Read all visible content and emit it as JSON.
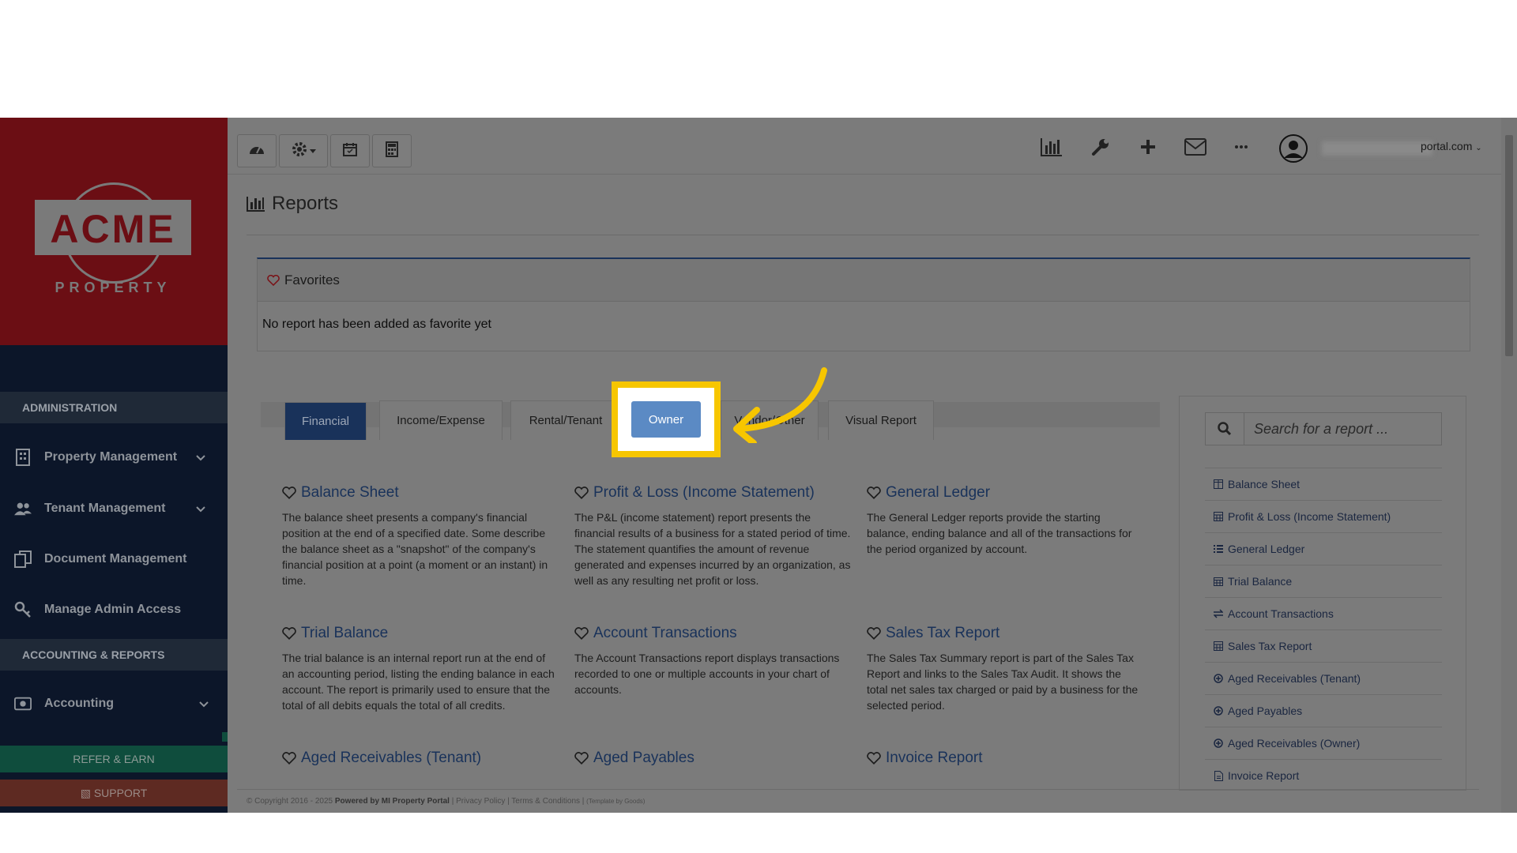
{
  "brand": {
    "logo_text": "ACME",
    "logo_sub": "PROPERTY"
  },
  "sidebar": {
    "section_admin": "ADMINISTRATION",
    "items": [
      {
        "label": "Property Management"
      },
      {
        "label": "Tenant Management"
      },
      {
        "label": "Document Management"
      },
      {
        "label": "Manage Admin Access"
      }
    ],
    "section_accounting": "ACCOUNTING & REPORTS",
    "accounting": "Accounting",
    "refer": "REFER & EARN",
    "support": "SUPPORT"
  },
  "topbar": {
    "user_email": "portal.com"
  },
  "page": {
    "title": "Reports"
  },
  "favorites": {
    "title": "Favorites",
    "empty": "No report has been added as favorite yet"
  },
  "tabs": [
    {
      "label": "Financial"
    },
    {
      "label": "Income/Expense"
    },
    {
      "label": "Rental/Tenant"
    },
    {
      "label": "Owner"
    },
    {
      "label": "Vendor/Other"
    },
    {
      "label": "Visual Report"
    }
  ],
  "reports": [
    {
      "title": "Balance Sheet",
      "desc": "The balance sheet presents a company's financial position at the end of a specified date. Some describe the balance sheet as a \"snapshot\" of the company's financial position at a point (a moment or an instant) in time."
    },
    {
      "title": "Profit & Loss (Income Statement)",
      "desc": "The P&L (income statement) report presents the financial results of a business for a stated period of time. The statement quantifies the amount of revenue generated and expenses incurred by an organization, as well as any resulting net profit or loss."
    },
    {
      "title": "General Ledger",
      "desc": "The General Ledger reports provide the starting balance, ending balance and all of the transactions for the period organized by account."
    },
    {
      "title": "Trial Balance",
      "desc": "The trial balance is an internal report run at the end of an accounting period, listing the ending balance in each account. The report is primarily used to ensure that the total of all debits equals the total of all credits."
    },
    {
      "title": "Account Transactions",
      "desc": "The Account Transactions report displays transactions recorded to one or multiple accounts in your chart of accounts."
    },
    {
      "title": "Sales Tax Report",
      "desc": "The Sales Tax Summary report is part of the Sales Tax Report and links to the Sales Tax Audit. It shows the total net sales tax charged or paid by a business for the selected period."
    },
    {
      "title": "Aged Receivables (Tenant)",
      "desc": ""
    },
    {
      "title": "Aged Payables",
      "desc": ""
    },
    {
      "title": "Invoice Report",
      "desc": ""
    }
  ],
  "search": {
    "placeholder": "Search for a report ..."
  },
  "quick_list": [
    {
      "label": "Balance Sheet",
      "icon": "columns-icon"
    },
    {
      "label": "Profit & Loss (Income Statement)",
      "icon": "calculator-icon"
    },
    {
      "label": "General Ledger",
      "icon": "list-icon"
    },
    {
      "label": "Trial Balance",
      "icon": "calendar-icon"
    },
    {
      "label": "Account Transactions",
      "icon": "exchange-icon"
    },
    {
      "label": "Sales Tax Report",
      "icon": "calculator-icon"
    },
    {
      "label": "Aged Receivables (Tenant)",
      "icon": "plus-circle-icon"
    },
    {
      "label": "Aged Payables",
      "icon": "plus-circle-icon"
    },
    {
      "label": "Aged Receivables (Owner)",
      "icon": "plus-circle-icon"
    },
    {
      "label": "Invoice Report",
      "icon": "file-icon"
    }
  ],
  "footer": {
    "copyright": "© Copyright 2016 - 2025",
    "powered": "Powered by MI Property Portal",
    "links": "| Privacy Policy | Terms & Conditions |",
    "version": "(Template by Goods)"
  },
  "colors": {
    "highlight": "#f7c600",
    "arrow": "#f7c600",
    "brand": "#6b0e14",
    "active_tab": "#19325a",
    "owner_button": "#5b8ac4"
  }
}
